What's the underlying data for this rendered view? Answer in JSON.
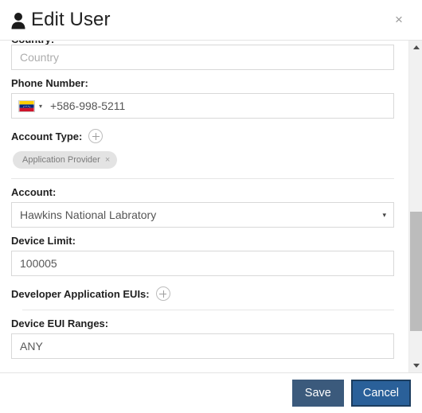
{
  "header": {
    "title": "Edit User",
    "user_icon": "person-icon",
    "close_icon": "close-icon",
    "close_label": "×"
  },
  "form": {
    "clipped_top_label": "Country:",
    "country": {
      "placeholder": "Country",
      "value": ""
    },
    "phone": {
      "label": "Phone Number:",
      "value": "+586-998-5211",
      "flag_country": "Venezuela",
      "flag_colors": [
        "#FFCC00",
        "#00247D",
        "#CF142B"
      ],
      "caret_icon": "chevron-down-icon"
    },
    "account_type": {
      "label": "Account Type:",
      "add_icon": "plus-circle-icon",
      "tags": [
        {
          "label": "Application Provider",
          "remove_icon": "close-icon",
          "remove_label": "×"
        }
      ]
    },
    "account": {
      "label": "Account:",
      "selected": "Hawkins National Labratory",
      "caret_icon": "chevron-down-icon",
      "caret_label": "▾"
    },
    "device_limit": {
      "label": "Device Limit:",
      "value": "100005"
    },
    "developer_application_euis": {
      "label": "Developer Application EUIs:",
      "add_icon": "plus-circle-icon"
    },
    "device_eui_ranges": {
      "label": "Device EUI Ranges:",
      "value": "ANY"
    }
  },
  "scrollbar": {
    "up_icon": "triangle-up-icon",
    "down_icon": "triangle-down-icon",
    "thumb": "scrollbar-thumb"
  },
  "footer": {
    "save_label": "Save",
    "cancel_label": "Cancel",
    "save_color": "#3b5a7c",
    "cancel_color": "#2a6099"
  }
}
